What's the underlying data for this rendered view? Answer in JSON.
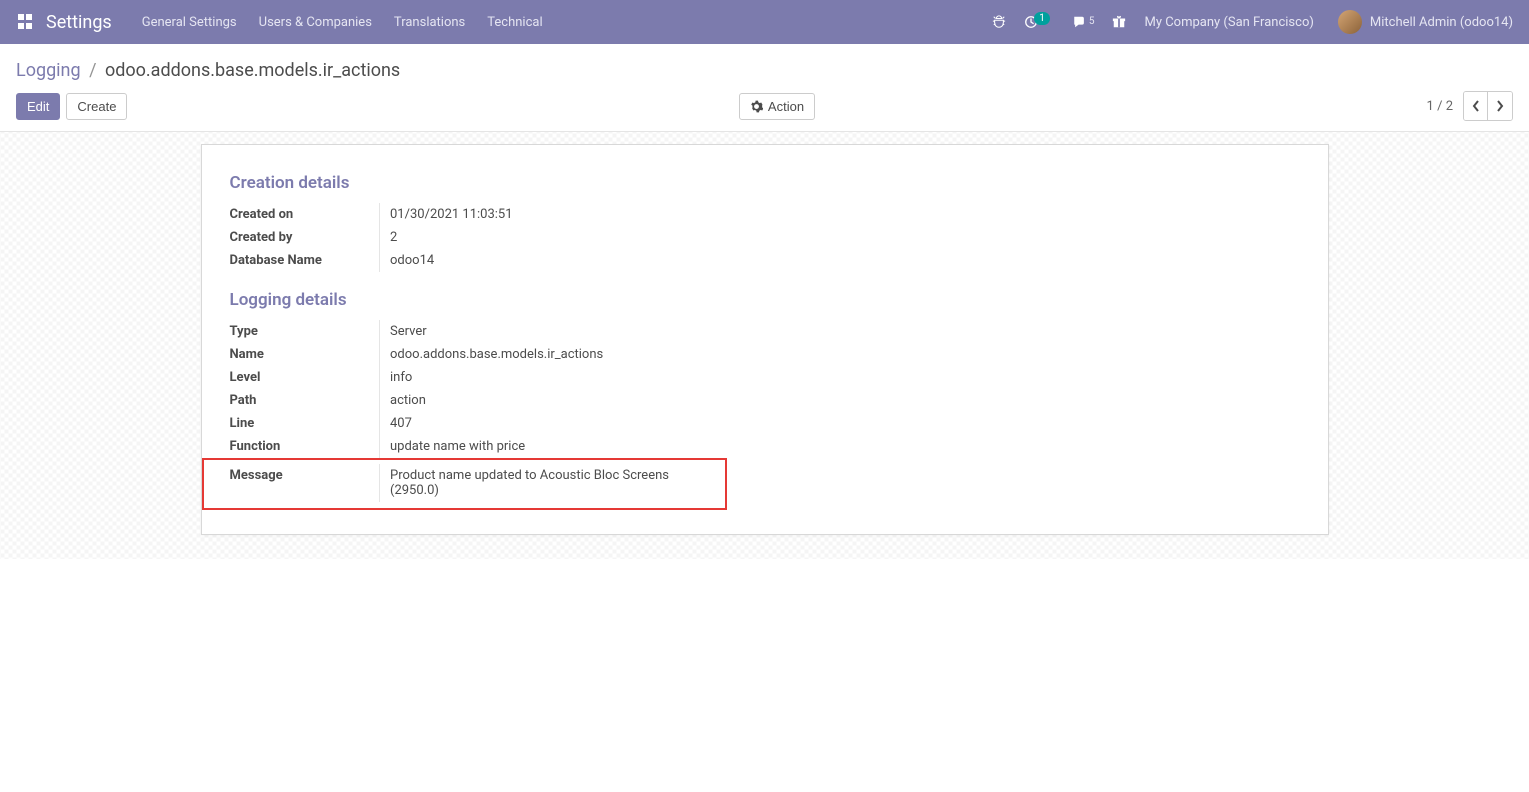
{
  "navbar": {
    "brand": "Settings",
    "menu": [
      "General Settings",
      "Users & Companies",
      "Translations",
      "Technical"
    ],
    "clock_badge": "1",
    "chat_badge": "5",
    "company": "My Company (San Francisco)",
    "user": "Mitchell Admin (odoo14)"
  },
  "breadcrumb": {
    "root": "Logging",
    "current": "odoo.addons.base.models.ir_actions"
  },
  "buttons": {
    "edit": "Edit",
    "create": "Create",
    "action": "Action"
  },
  "pager": {
    "pos": "1",
    "sep": "/",
    "total": "2"
  },
  "sections": {
    "creation": {
      "title": "Creation details",
      "rows": {
        "created_on": {
          "label": "Created on",
          "value": "01/30/2021 11:03:51"
        },
        "created_by": {
          "label": "Created by",
          "value": "2"
        },
        "db": {
          "label": "Database Name",
          "value": "odoo14"
        }
      }
    },
    "logging": {
      "title": "Logging details",
      "rows": {
        "type": {
          "label": "Type",
          "value": "Server"
        },
        "name": {
          "label": "Name",
          "value": "odoo.addons.base.models.ir_actions"
        },
        "level": {
          "label": "Level",
          "value": "info"
        },
        "path": {
          "label": "Path",
          "value": "action"
        },
        "line": {
          "label": "Line",
          "value": "407"
        },
        "function": {
          "label": "Function",
          "value": "update name with price"
        },
        "message": {
          "label": "Message",
          "value": "Product name updated to Acoustic Bloc Screens (2950.0)"
        }
      }
    }
  }
}
